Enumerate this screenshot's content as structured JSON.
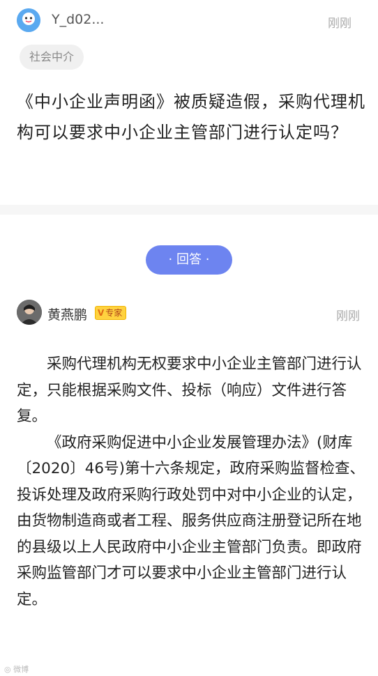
{
  "question": {
    "username": "Y_d02...",
    "time": "刚刚",
    "tag": "社会中介",
    "title": "《中小企业声明函》被质疑造假，采购代理机构可以要求中小企业主管部门进行认定吗？"
  },
  "answer_button": "· 回答 ·",
  "answer": {
    "name": "黄燕鹏",
    "badge": "专家",
    "time": "刚刚",
    "paragraphs": [
      "采购代理机构无权要求中小企业主管部门进行认定，只能根据采购文件、投标（响应）文件进行答复。",
      "《政府采购促进中小企业发展管理办法》(财库〔2020〕46号)第十六条规定，政府采购监督检查、投诉处理及政府采购行政处罚中对中小企业的认定，由货物制造商或者工程、服务供应商注册登记所在地的县级以上人民政府中小企业主管部门负责。即政府采购监管部门才可以要求中小企业主管部门进行认定。"
    ]
  },
  "watermark": "微博"
}
